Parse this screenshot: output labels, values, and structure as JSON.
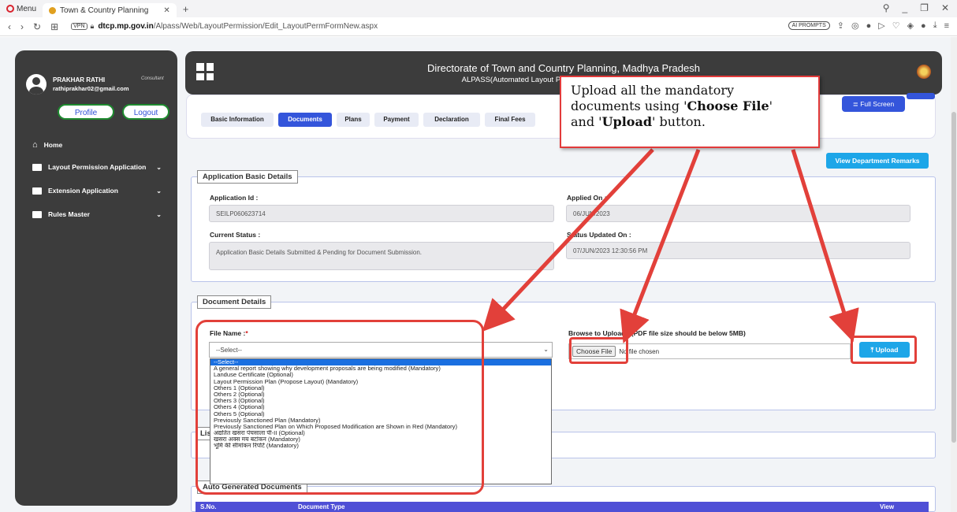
{
  "browser": {
    "menu_label": "Menu",
    "tab_title": "Town & Country Planning",
    "url_host": "dtcp.mp.gov.in",
    "url_path": "/Alpass/Web/LayoutPermission/Edit_LayoutPermFormNew.aspx",
    "vpn_label": "VPN",
    "ai_prompts_label": "AI PROMPTS"
  },
  "sidebar": {
    "user_name": "PRAKHAR RATHI",
    "user_email": "rathiprakhar02@gmail.com",
    "user_role": "Consultant",
    "profile_label": "Profile",
    "logout_label": "Logout",
    "items": [
      {
        "label": "Home"
      },
      {
        "label": "Layout Permission Application"
      },
      {
        "label": "Extension Application"
      },
      {
        "label": "Rules Master"
      }
    ]
  },
  "header": {
    "title": "Directorate of Town and Country Planning, Madhya Pradesh",
    "subtitle": "ALPASS(Automated Layout Proc"
  },
  "tabs": [
    "Basic Information",
    "Documents",
    "Plans",
    "Payment",
    "Declaration",
    "Final Fees"
  ],
  "active_tab": "Documents",
  "full_screen_label": "≣ Full Screen",
  "view_remarks_label": "View Department Remarks",
  "basic_details": {
    "legend": "Application Basic Details",
    "app_id_label": "Application Id :",
    "app_id_value": "SEILP060623714",
    "applied_on_label": "Applied On :",
    "applied_on_value": "06/JUN/2023",
    "status_label": "Current Status :",
    "status_value": "Application Basic Details Submitted & Pending for Document Submission.",
    "status_updated_label": "Status Updated On :",
    "status_updated_value": "07/JUN/2023 12:30:56 PM"
  },
  "document_details": {
    "legend": "Document Details",
    "file_name_label": "File Name :",
    "file_name_req": "*",
    "select_value": "--Select--",
    "browse_label": "Browse to Upload : (PDF file size should be below 5MB)",
    "choose_file_label": "Choose File",
    "no_file_label": "No file chosen",
    "upload_label": "⤒ Upload",
    "options": [
      "--Select--",
      "A general report showing why development proposals are being modified (Mandatory)",
      "Landuse Certificate (Optional)",
      "Layout Permission Plan (Propose Layout) (Mandatory)",
      "Others 1 (Optional)",
      "Others 2 (Optional)",
      "Others 3 (Optional)",
      "Others 4 (Optional)",
      "Others 5 (Optional)",
      "Previously Sanctioned Plan (Mandatory)",
      "Previously Sanctioned Plan on Which Proposed Modification are Shown in Red (Mandatory)",
      "अद्यतित खसरा पंचसाला पी-II (Optional)",
      "खसरा अक्स मय बटांकन (Mandatory)",
      "भूमि की सीमांकन रिपोर्ट (Mandatory)"
    ]
  },
  "list_legend_partial": "Lis",
  "auto_docs_legend": "Auto Generated Documents",
  "table_headers": [
    "S.No.",
    "Document Type",
    "View"
  ],
  "callout": {
    "line1": "Upload all the mandatory",
    "line2_pre": "documents using '",
    "line2_bold": "Choose File",
    "line2_post": "'",
    "line3_pre": "and '",
    "line3_bold": "Upload",
    "line3_post": "' button."
  },
  "colors": {
    "primary_blue": "#3455db",
    "info_blue": "#1da6e8",
    "annotation_red": "#e2403a",
    "sidebar_dark": "#3c3c3c"
  }
}
